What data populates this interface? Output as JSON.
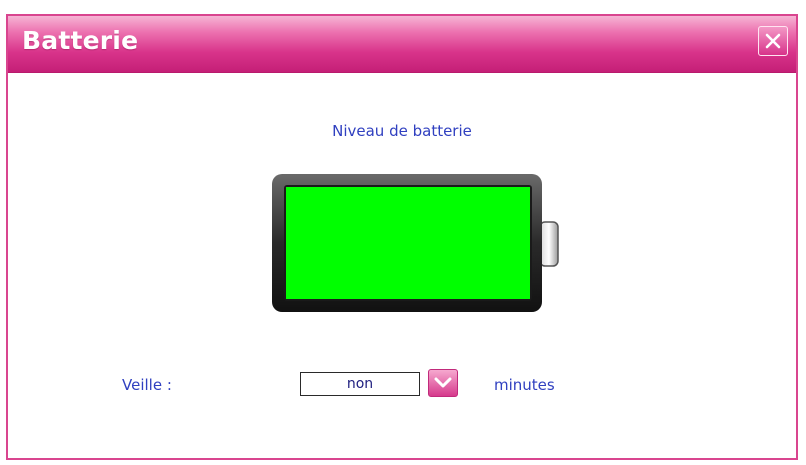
{
  "window": {
    "title": "Batterie"
  },
  "battery": {
    "label": "Niveau de batterie",
    "level": 1.0,
    "fill_color": "#00ff00"
  },
  "sleep": {
    "label": "Veille :",
    "selected_value": "non",
    "units": "minutes"
  },
  "icons": {
    "close": "close-icon",
    "dropdown": "chevron-down-icon"
  },
  "colors": {
    "titlebar": "#d8338a",
    "text": "#3040c0"
  }
}
